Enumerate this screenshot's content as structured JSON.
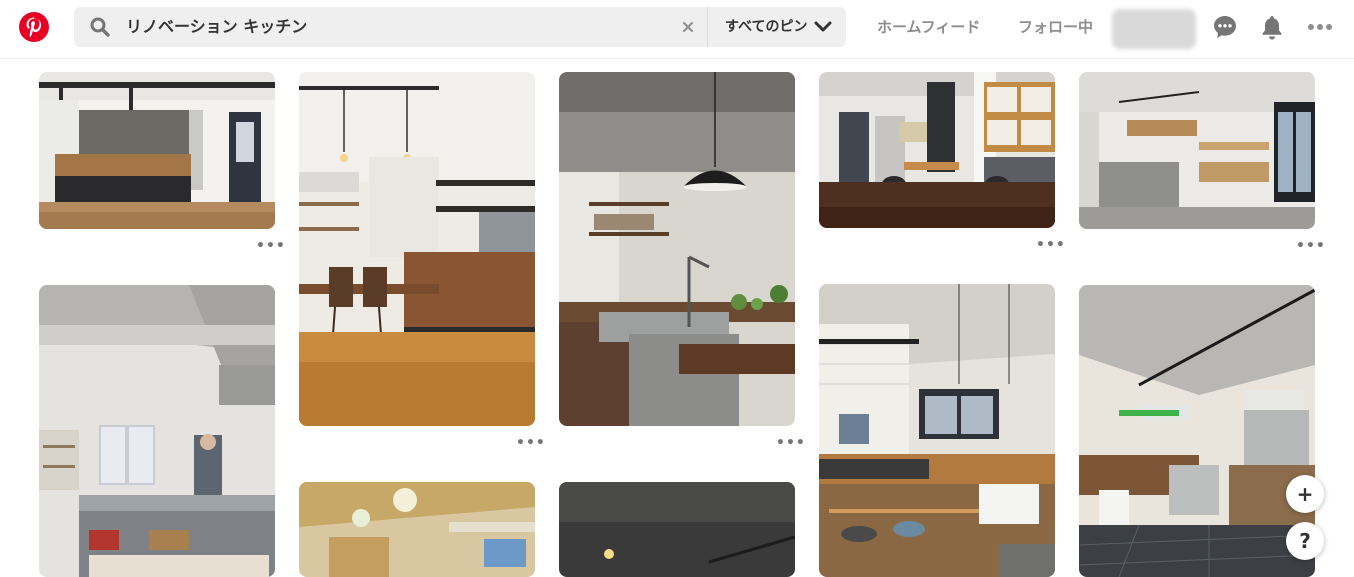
{
  "search": {
    "query": "リノベーション キッチン",
    "filter_label": "すべてのピン"
  },
  "nav": {
    "home_feed": "ホームフィード",
    "following": "フォロー中"
  },
  "pin_more_label": "•••",
  "fab": {
    "add_label": "+",
    "help_label": "?"
  },
  "colors": {
    "brand": "#e60023",
    "search_bg": "#efefef",
    "nav_text": "#8e8e8e"
  },
  "icons": [
    "pinterest-logo-icon",
    "search-icon",
    "clear-icon",
    "chevron-down-icon",
    "messages-icon",
    "notifications-icon",
    "more-options-icon"
  ]
}
